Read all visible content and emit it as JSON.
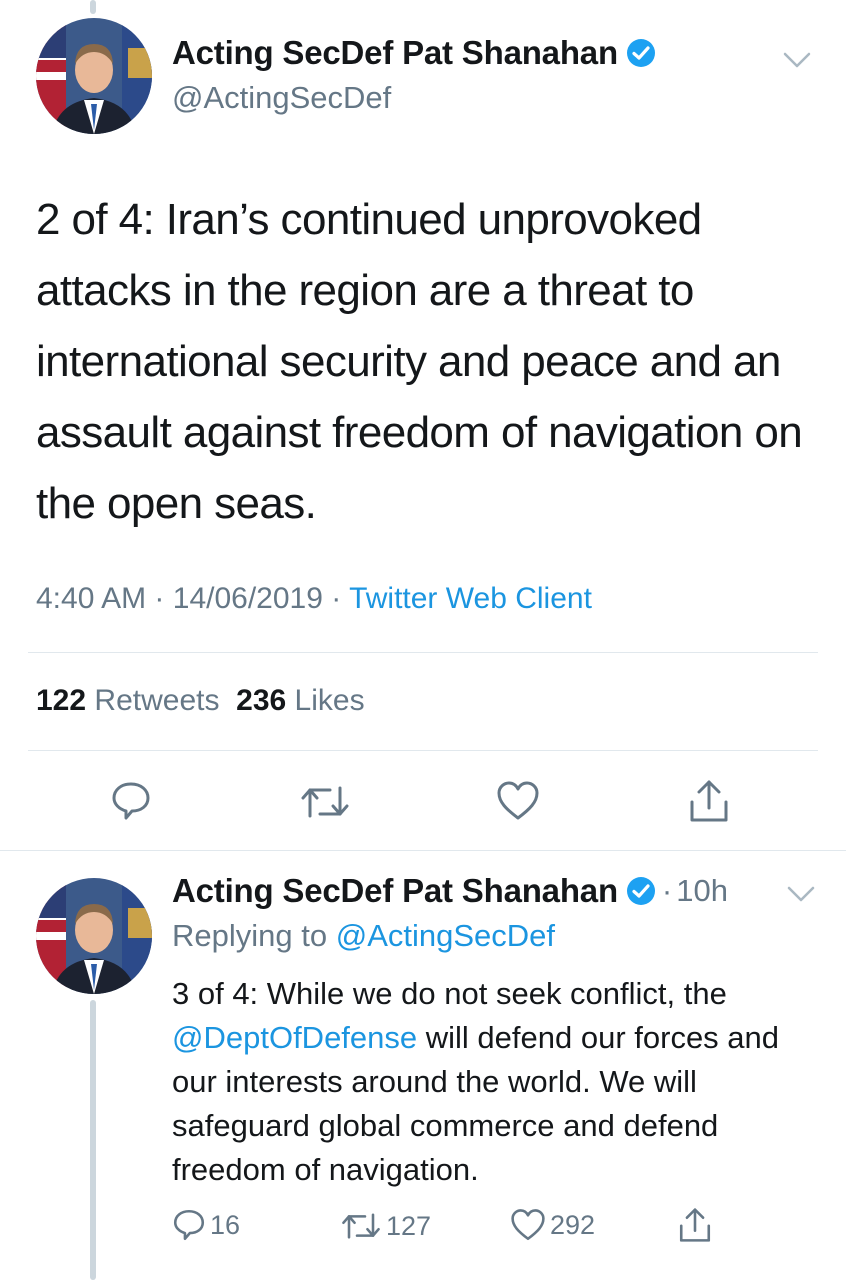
{
  "tweet": {
    "author_name": "Acting SecDef Pat Shanahan",
    "author_handle": "@ActingSecDef",
    "text": "2 of 4: Iran’s continued unprovoked attacks in the region are a threat to international security and peace and an assault against freedom of navigation on the open seas.",
    "time": "4:40 AM",
    "date": "14/06/2019",
    "separator": "·",
    "source": "Twitter Web Client",
    "retweet_count": "122",
    "retweet_label": "Retweets",
    "like_count": "236",
    "like_label": "Likes"
  },
  "reply": {
    "author_name": "Acting SecDef Pat Shanahan",
    "dot": "·",
    "time": "10h",
    "replying_label": "Replying to",
    "replying_handle": "@ActingSecDef",
    "text_before": "3 of 4: While we do not seek conflict, the ",
    "mention": "@DeptOfDefense",
    "text_after": " will defend our forces and our interests around the world. We will safeguard global commerce and defend freedom of navigation.",
    "reply_count": "16",
    "retweet_count": "127",
    "like_count": "292"
  },
  "icons": {
    "verified": "verified-badge-icon",
    "chevron": "chevron-down-icon",
    "reply": "reply-icon",
    "retweet": "retweet-icon",
    "like": "heart-icon",
    "share": "share-icon"
  },
  "colors": {
    "accent": "#1b95e0",
    "muted": "#657786",
    "text": "#14171a",
    "divider": "#e1e8ed",
    "thread_line": "#ccd6dd"
  }
}
